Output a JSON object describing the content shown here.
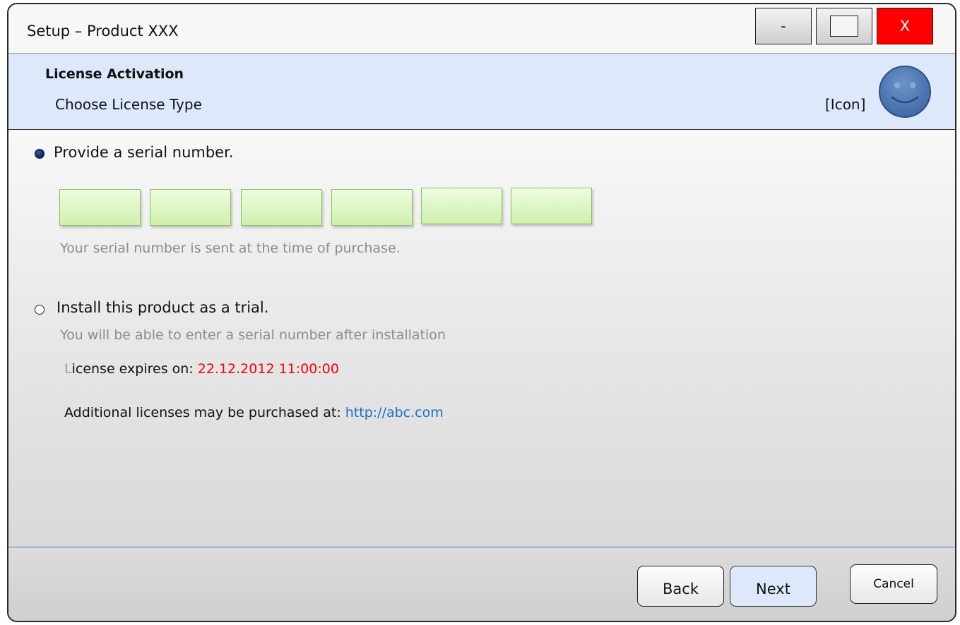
{
  "window": {
    "title": "Setup – Product XXX",
    "controls": {
      "minimize": "-",
      "close": "X"
    }
  },
  "header": {
    "title": "License Activation",
    "subtitle": "Choose License Type",
    "icon_label": "[Icon]",
    "icon": "smiley-icon"
  },
  "options": {
    "serial": {
      "label": "Provide a serial number.",
      "selected": true,
      "fields": [
        "",
        "",
        "",
        "",
        "",
        ""
      ],
      "hint": "Your serial number is sent at the time of purchase."
    },
    "trial": {
      "label": "Install this product as a trial.",
      "selected": false,
      "hint": "You will be able to enter a serial number after installation"
    }
  },
  "license": {
    "expires_first_letter": "L",
    "expires_label_rest": "icense expires on: ",
    "expires_value": "22.12.2012 11:00:00",
    "purchase_label": "Additional licenses may be purchased at: ",
    "purchase_link": "http://abc.com"
  },
  "footer": {
    "back": "Back",
    "next": "Next",
    "cancel": "Cancel"
  },
  "colors": {
    "close_button": "#ff0000",
    "header_bg": "#dde9fa",
    "expiry_text": "#ff0000",
    "link_text": "#1a6fc4",
    "serial_field_bg": "#d0f0ac"
  }
}
